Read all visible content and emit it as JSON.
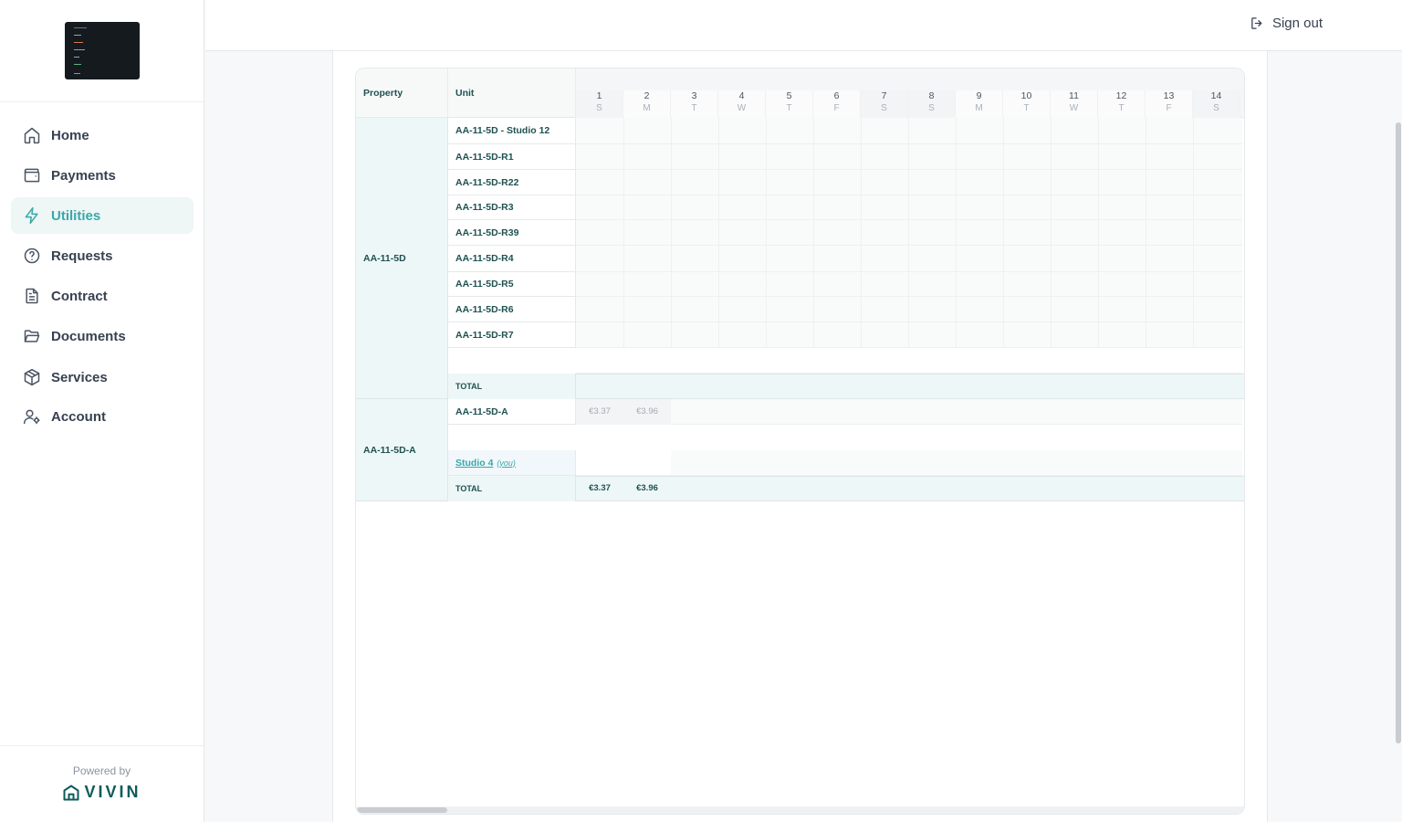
{
  "nav": [
    {
      "label": "Home",
      "icon": "home-icon"
    },
    {
      "label": "Payments",
      "icon": "wallet-icon"
    },
    {
      "label": "Utilities",
      "icon": "lightning-icon",
      "active": true
    },
    {
      "label": "Requests",
      "icon": "question-icon"
    },
    {
      "label": "Contract",
      "icon": "document-icon"
    },
    {
      "label": "Documents",
      "icon": "folder-icon"
    },
    {
      "label": "Services",
      "icon": "box-icon"
    },
    {
      "label": "Account",
      "icon": "user-settings-icon"
    }
  ],
  "footer": {
    "powered_by": "Powered by",
    "brand": "VIVIN"
  },
  "topbar": {
    "sign_out": "Sign out"
  },
  "table": {
    "headers": {
      "property": "Property",
      "unit": "Unit"
    },
    "days": [
      {
        "n": "1",
        "l": "S"
      },
      {
        "n": "2",
        "l": "M"
      },
      {
        "n": "3",
        "l": "T"
      },
      {
        "n": "4",
        "l": "W"
      },
      {
        "n": "5",
        "l": "T"
      },
      {
        "n": "6",
        "l": "F"
      },
      {
        "n": "7",
        "l": "S"
      },
      {
        "n": "8",
        "l": "S"
      },
      {
        "n": "9",
        "l": "M"
      },
      {
        "n": "10",
        "l": "T"
      },
      {
        "n": "11",
        "l": "W"
      },
      {
        "n": "12",
        "l": "T"
      },
      {
        "n": "13",
        "l": "F"
      },
      {
        "n": "14",
        "l": "S"
      }
    ],
    "groups": [
      {
        "property": "AA-11-5D",
        "units": [
          "AA-11-5D - Studio 12",
          "AA-11-5D-R1",
          "AA-11-5D-R22",
          "AA-11-5D-R3",
          "AA-11-5D-R39",
          "AA-11-5D-R4",
          "AA-11-5D-R5",
          "AA-11-5D-R6",
          "AA-11-5D-R7"
        ],
        "total_label": "TOTAL"
      },
      {
        "property": "AA-11-5D-A",
        "units": [
          "AA-11-5D-A"
        ],
        "unit_values": [
          "€3.37",
          "€3.96"
        ],
        "own_unit": "Studio 4",
        "own_tag": "(you)",
        "total_label": "TOTAL",
        "total_values": [
          "€3.37",
          "€3.96"
        ]
      }
    ]
  }
}
